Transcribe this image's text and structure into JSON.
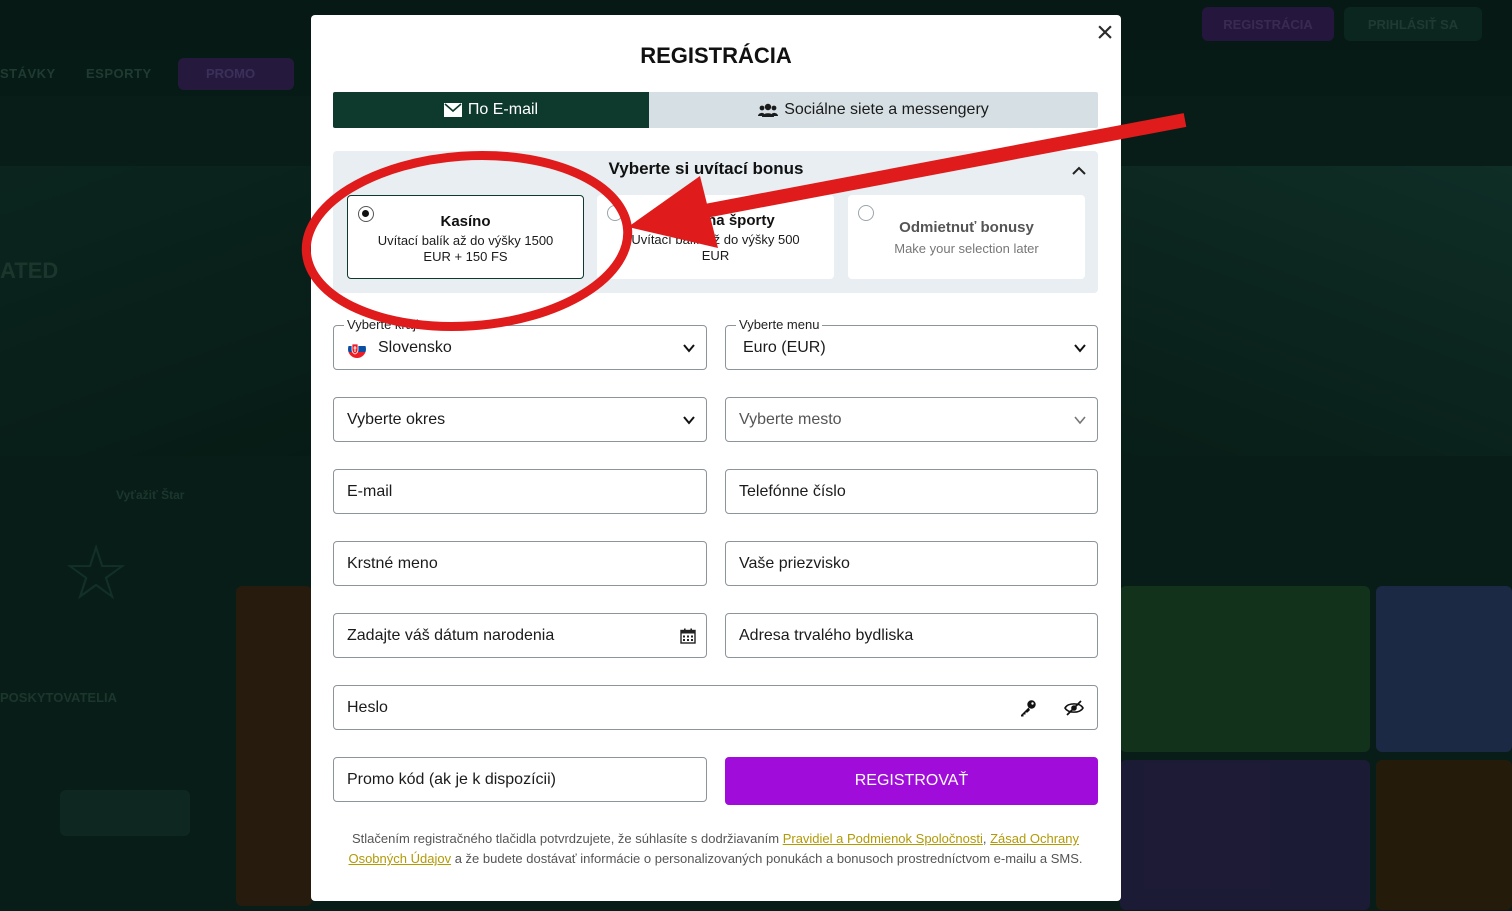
{
  "background": {
    "nav": [
      "STÁVKY",
      "ESPORTY",
      "PROMO"
    ],
    "header_buttons": {
      "register": "REGISTRÁCIA",
      "login": "PRIHLÁSIŤ SA"
    },
    "banner_left_text": "ATED",
    "section_label": "Vyťažiť Štar",
    "providers_label": "POSKYTOVATELIA"
  },
  "modal": {
    "title": "REGISTRÁCIA",
    "close_glyph": "×",
    "tabs": [
      {
        "label": "По E-mail",
        "icon": "envelope-icon",
        "active": true
      },
      {
        "label": "Sociálne siete a messengery",
        "icon": "users-icon",
        "active": false
      }
    ],
    "bonus": {
      "title": "Vyberte si uvítací bonus",
      "options": [
        {
          "title": "Kasíno",
          "desc_line1": "Uvítací balík až do výšky 1500",
          "desc_line2": "EUR + 150 FS",
          "selected": true
        },
        {
          "title": "Bonus na športy",
          "desc_line1": "Uvítací balík až do výšky 500",
          "desc_line2": "EUR",
          "selected": false
        },
        {
          "title": "Odmietnuť bonusy",
          "desc_line1": "Make your selection later",
          "desc_line2": "",
          "selected": false
        }
      ]
    },
    "fields": {
      "country": {
        "label": "Vyberte krajinu",
        "value": "Slovensko"
      },
      "currency": {
        "label": "Vyberte menu",
        "value": "Euro (EUR)"
      },
      "district": {
        "placeholder": "Vyberte okres"
      },
      "city": {
        "placeholder": "Vyberte mesto"
      },
      "email": {
        "placeholder": "E-mail"
      },
      "phone": {
        "placeholder": "Telefónne číslo"
      },
      "first_name": {
        "placeholder": "Krstné meno"
      },
      "last_name": {
        "placeholder": "Vaše priezvisko"
      },
      "birthdate": {
        "placeholder": "Zadajte váš dátum narodenia"
      },
      "address": {
        "placeholder": "Adresa trvalého bydliska"
      },
      "password": {
        "placeholder": "Heslo"
      },
      "promo": {
        "placeholder": "Promo kód (ak je k dispozícii)"
      }
    },
    "submit_label": "REGISTROVAŤ",
    "terms": {
      "prefix": "Stlačením registračného tlačidla potvrdzujete, že súhlasíte s dodržiavaním",
      "link1": "Pravidiel a Podmienok Spoločnosti",
      "comma": ",",
      "link2": "Zásad Ochrany Osobných Údajov",
      "suffix": "a že budete dostávať informácie o personalizovaných ponukách a bonusoch prostredníctvom e-mailu a SMS."
    }
  },
  "colors": {
    "tab_active": "#0e3a2d",
    "submit": "#a00cd9",
    "link": "#b29a05",
    "annotation": "#e01b1b"
  }
}
